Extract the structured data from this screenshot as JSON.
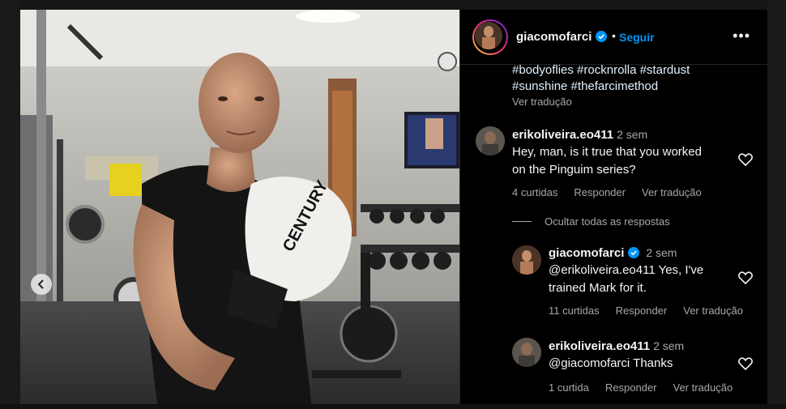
{
  "post": {
    "username": "giacomofarci",
    "follow_label": "Seguir",
    "caption_line1": "#bodyoflies #rocknrolla #stardust",
    "caption_line2": "#sunshine #thefarcimethod",
    "translate": "Ver tradução"
  },
  "photo": {
    "glove_brand": "CENTURY"
  },
  "comments": [
    {
      "username": "erikoliveira.eo411",
      "time": "2 sem",
      "text_line1": "Hey, man, is it true that you worked",
      "text_line2": "on the Pinguim series?",
      "likes": "4 curtidas",
      "reply": "Responder",
      "translate": "Ver tradução"
    }
  ],
  "hide_replies": "Ocultar todas as respostas",
  "replies": [
    {
      "username": "giacomofarci",
      "time": "2 sem",
      "text_line1": "@erikoliveira.eo411 Yes, I've",
      "text_line2": "trained Mark for it.",
      "likes": "11 curtidas",
      "reply": "Responder",
      "translate": "Ver tradução"
    },
    {
      "username": "erikoliveira.eo411",
      "time": "2 sem",
      "text_line1": "@giacomofarci Thanks",
      "likes": "1 curtida",
      "reply": "Responder",
      "translate": "Ver tradução"
    }
  ],
  "colors": {
    "accent": "#0095f6",
    "muted": "#a8a8a8",
    "background": "#000000"
  }
}
